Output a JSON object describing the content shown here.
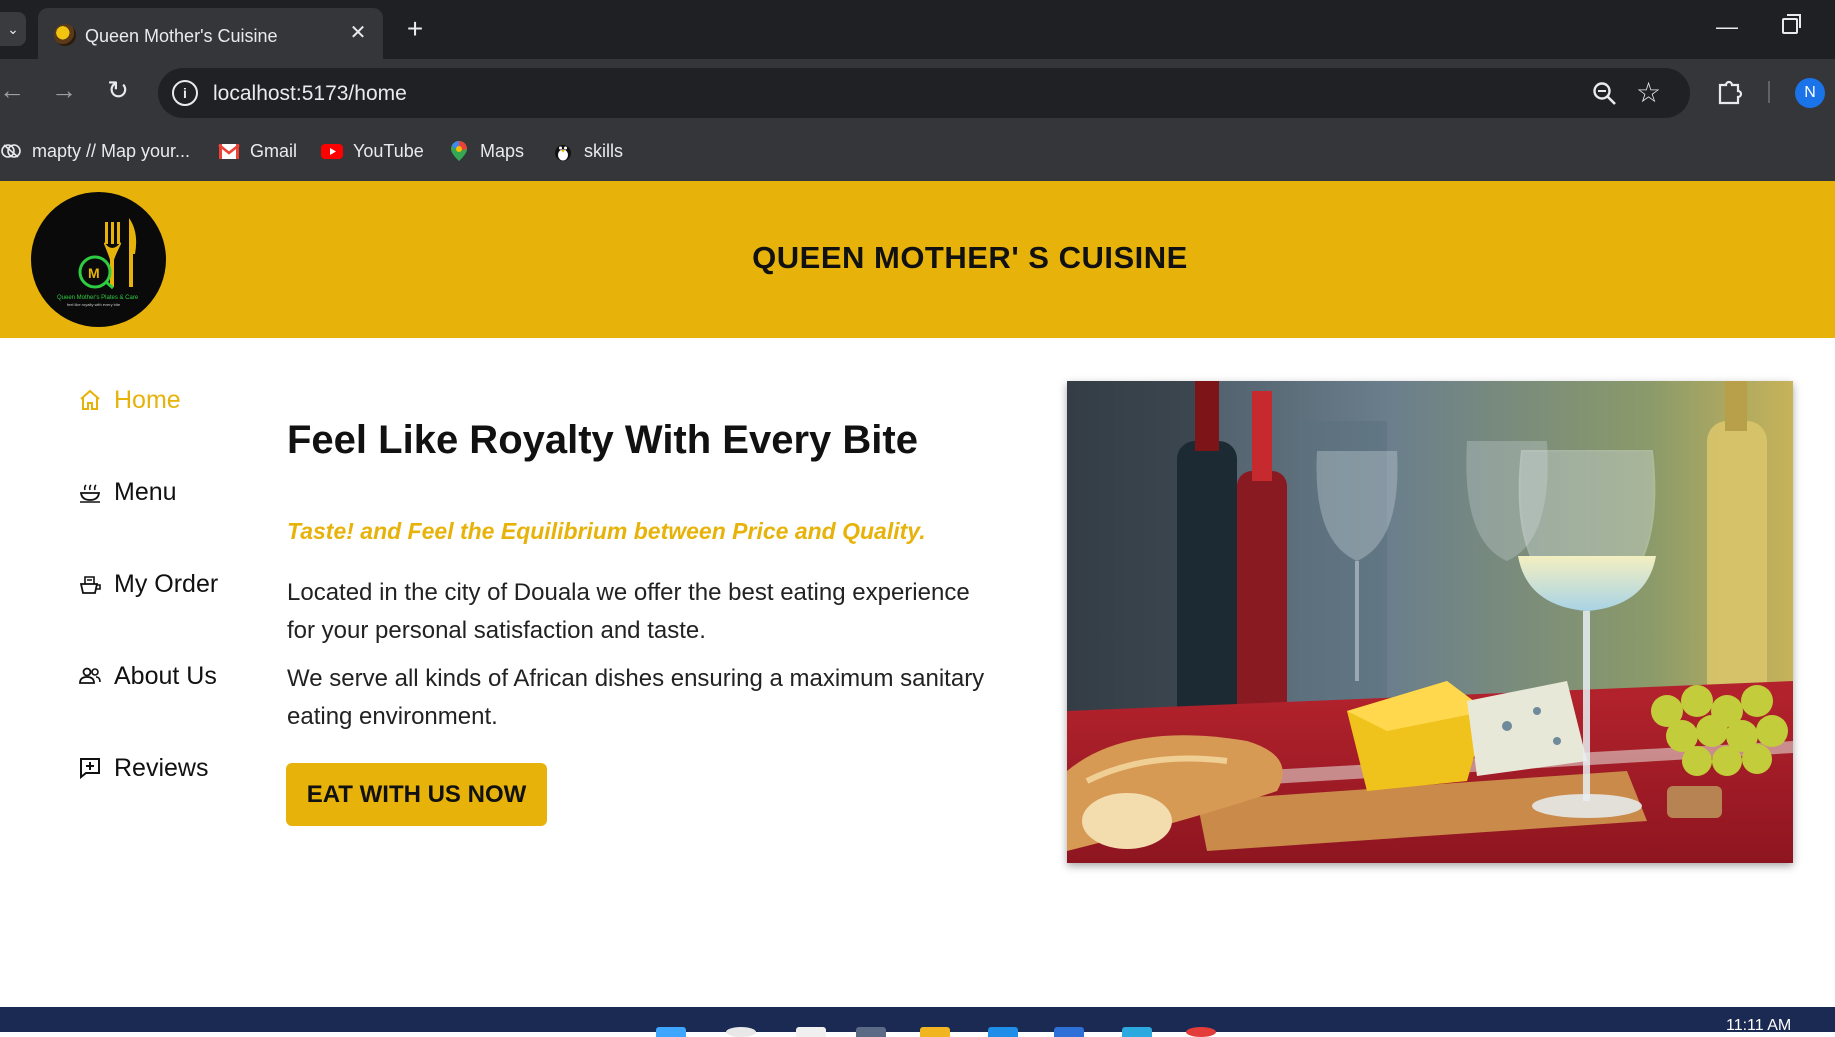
{
  "browser": {
    "tab_title": "Queen Mother's Cuisine",
    "url": "localhost:5173/home",
    "profile_initial": "N",
    "bookmarks": [
      {
        "label": "mapty // Map your...",
        "icon": "mapty-icon"
      },
      {
        "label": "Gmail",
        "icon": "gmail-icon"
      },
      {
        "label": "YouTube",
        "icon": "youtube-icon"
      },
      {
        "label": "Maps",
        "icon": "maps-icon"
      },
      {
        "label": "skills",
        "icon": "skills-icon"
      }
    ]
  },
  "header": {
    "title": "QUEEN MOTHER' S CUISINE",
    "logo_text": "Queen Mother's Plates & Care",
    "logo_tagline": "feel like royalty with every bite",
    "logo_initials": "M"
  },
  "nav": {
    "items": [
      {
        "label": "Home",
        "icon": "home-icon",
        "active": true
      },
      {
        "label": "Menu",
        "icon": "food-icon",
        "active": false
      },
      {
        "label": "My Order",
        "icon": "order-icon",
        "active": false
      },
      {
        "label": "About Us",
        "icon": "users-icon",
        "active": false
      },
      {
        "label": "Reviews",
        "icon": "review-icon",
        "active": false
      }
    ]
  },
  "hero": {
    "title": "Feel Like Royalty With Every Bite",
    "tagline": "Taste! and Feel the Equilibrium between Price and Quality.",
    "paragraph1": "Located in the city of Douala we offer the best eating experience for your personal satisfaction and taste.",
    "paragraph2": "We serve all kinds of African dishes ensuring a maximum sanitary eating environment.",
    "cta": "EAT WITH US NOW"
  },
  "taskbar": {
    "clock": "11:11 AM"
  },
  "colors": {
    "accent": "#e7b30b",
    "chrome_dark": "#1f2023",
    "chrome": "#35363a"
  }
}
